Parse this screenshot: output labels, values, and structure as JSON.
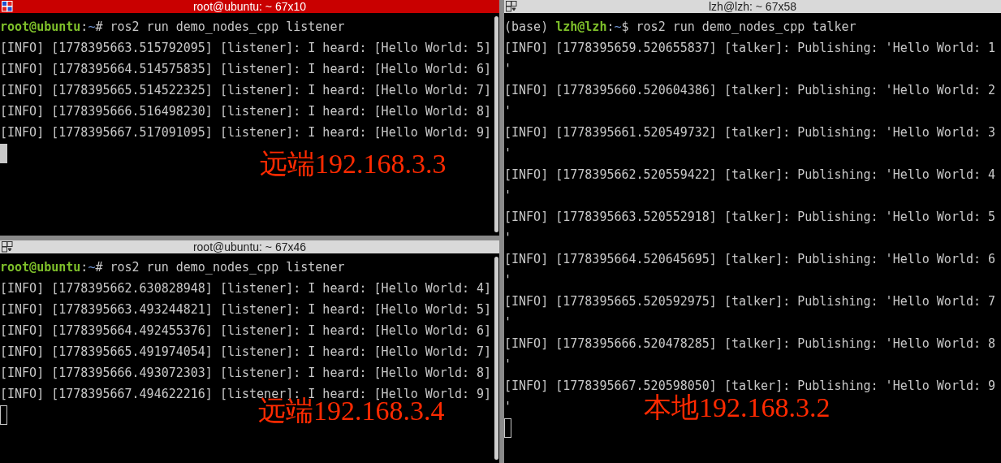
{
  "left_panes": [
    {
      "title": "root@ubuntu: ~ 67x10",
      "focused": true,
      "prompt": {
        "user_host": "root@ubuntu",
        "separator": ":",
        "path": "~",
        "symbol": "# ",
        "command": "ros2 run demo_nodes_cpp listener"
      },
      "lines": [
        "[INFO] [1778395663.515792095] [listener]: I heard: [Hello World: 5]",
        "[INFO] [1778395664.514575835] [listener]: I heard: [Hello World: 6]",
        "[INFO] [1778395665.514522325] [listener]: I heard: [Hello World: 7]",
        "[INFO] [1778395666.516498230] [listener]: I heard: [Hello World: 8]",
        "[INFO] [1778395667.517091095] [listener]: I heard: [Hello World: 9]"
      ],
      "annotation": "远端192.168.3.3"
    },
    {
      "title": "root@ubuntu: ~ 67x46",
      "focused": false,
      "prompt": {
        "user_host": "root@ubuntu",
        "separator": ":",
        "path": "~",
        "symbol": "# ",
        "command": "ros2 run demo_nodes_cpp listener"
      },
      "lines": [
        "[INFO] [1778395662.630828948] [listener]: I heard: [Hello World: 4]",
        "[INFO] [1778395663.493244821] [listener]: I heard: [Hello World: 5]",
        "[INFO] [1778395664.492455376] [listener]: I heard: [Hello World: 6]",
        "[INFO] [1778395665.491974054] [listener]: I heard: [Hello World: 7]",
        "[INFO] [1778395666.493072303] [listener]: I heard: [Hello World: 8]",
        "[INFO] [1778395667.494622216] [listener]: I heard: [Hello World: 9]"
      ],
      "annotation": "远端192.168.3.4"
    }
  ],
  "right_pane": {
    "title": "lzh@lzh: ~ 67x58",
    "focused": false,
    "prompt": {
      "prefix": "(base) ",
      "user_host": "lzh@lzh",
      "separator": ":",
      "path": "~",
      "symbol": "$ ",
      "command": "ros2 run demo_nodes_cpp talker"
    },
    "lines": [
      "[INFO] [1778395659.520655837] [talker]: Publishing: 'Hello World: 1",
      "'",
      "[INFO] [1778395660.520604386] [talker]: Publishing: 'Hello World: 2",
      "'",
      "[INFO] [1778395661.520549732] [talker]: Publishing: 'Hello World: 3",
      "'",
      "[INFO] [1778395662.520559422] [talker]: Publishing: 'Hello World: 4",
      "'",
      "[INFO] [1778395663.520552918] [talker]: Publishing: 'Hello World: 5",
      "'",
      "[INFO] [1778395664.520645695] [talker]: Publishing: 'Hello World: 6",
      "'",
      "[INFO] [1778395665.520592975] [talker]: Publishing: 'Hello World: 7",
      "'",
      "[INFO] [1778395666.520478285] [talker]: Publishing: 'Hello World: 8",
      "'",
      "[INFO] [1778395667.520598050] [talker]: Publishing: 'Hello World: 9",
      "'"
    ],
    "annotation": "本地192.168.3.2"
  }
}
